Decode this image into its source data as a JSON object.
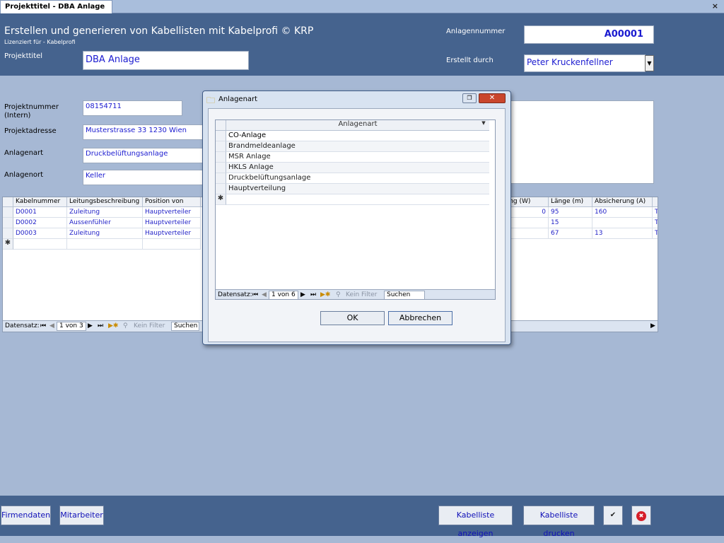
{
  "tab": {
    "title": "Projekttitel - DBA Anlage",
    "close": "×"
  },
  "header": {
    "title": "Erstellen und generieren von Kabellisten mit Kabelprofi © KRP",
    "license": "Lizenziert für - Kabelprofi",
    "project_title_label": "Projekttitel",
    "project_title_value": "DBA Anlage",
    "plant_number_label": "Anlagennummer",
    "plant_number_value": "A00001",
    "created_by_label": "Erstellt durch",
    "created_by_value": "Peter Kruckenfellner"
  },
  "form": {
    "project_number_label": "Projektnummer\n(Intern)",
    "project_number_value": "08154711",
    "project_address_label": "Projektadresse",
    "project_address_value": "Musterstrasse 33 1230 Wien",
    "plant_type_label": "Anlagenart",
    "plant_type_value": "Druckbelüftungsanlage",
    "plant_location_label": "Anlagenort",
    "plant_location_value": "Keller"
  },
  "grid": {
    "columns": [
      "Kabelnummer",
      "Leitungsbeschreibung",
      "Position von",
      "tung (W)",
      "Länge (m)",
      "Absicherung (A)"
    ],
    "rows": [
      [
        "D0001",
        "Zuleitung",
        "Hauptverteiler",
        "0",
        "95",
        "160",
        "T"
      ],
      [
        "D0002",
        "Aussenfühler",
        "Hauptverteiler",
        "",
        "15",
        "",
        "T"
      ],
      [
        "D0003",
        "Zuleitung",
        "Hauptverteiler",
        "",
        "67",
        "13",
        "T"
      ]
    ],
    "new_row_marker": "✱",
    "nav": {
      "label": "Datensatz:",
      "position": "1 von 3",
      "filter": "Kein Filter",
      "search": "Suchen"
    }
  },
  "dialog": {
    "title": "Anlagenart",
    "column": "Anlagenart",
    "rows": [
      "CO-Anlage",
      "Brandmeldeanlage",
      "MSR Anlage",
      "HKLS Anlage",
      "Druckbelüftungsanlage",
      "Hauptverteilung"
    ],
    "new_row_marker": "✱",
    "nav": {
      "label": "Datensatz:",
      "position": "1 von 6",
      "filter": "Kein Filter",
      "search": "Suchen"
    },
    "ok": "OK",
    "cancel": "Abbrechen"
  },
  "footer": {
    "company_data": "Firmendaten",
    "employees": "Mitarbeiter",
    "show_list": "Kabelliste anzeigen",
    "print_list": "Kabelliste drucken",
    "confirm": "✔",
    "cancel": "✖"
  }
}
